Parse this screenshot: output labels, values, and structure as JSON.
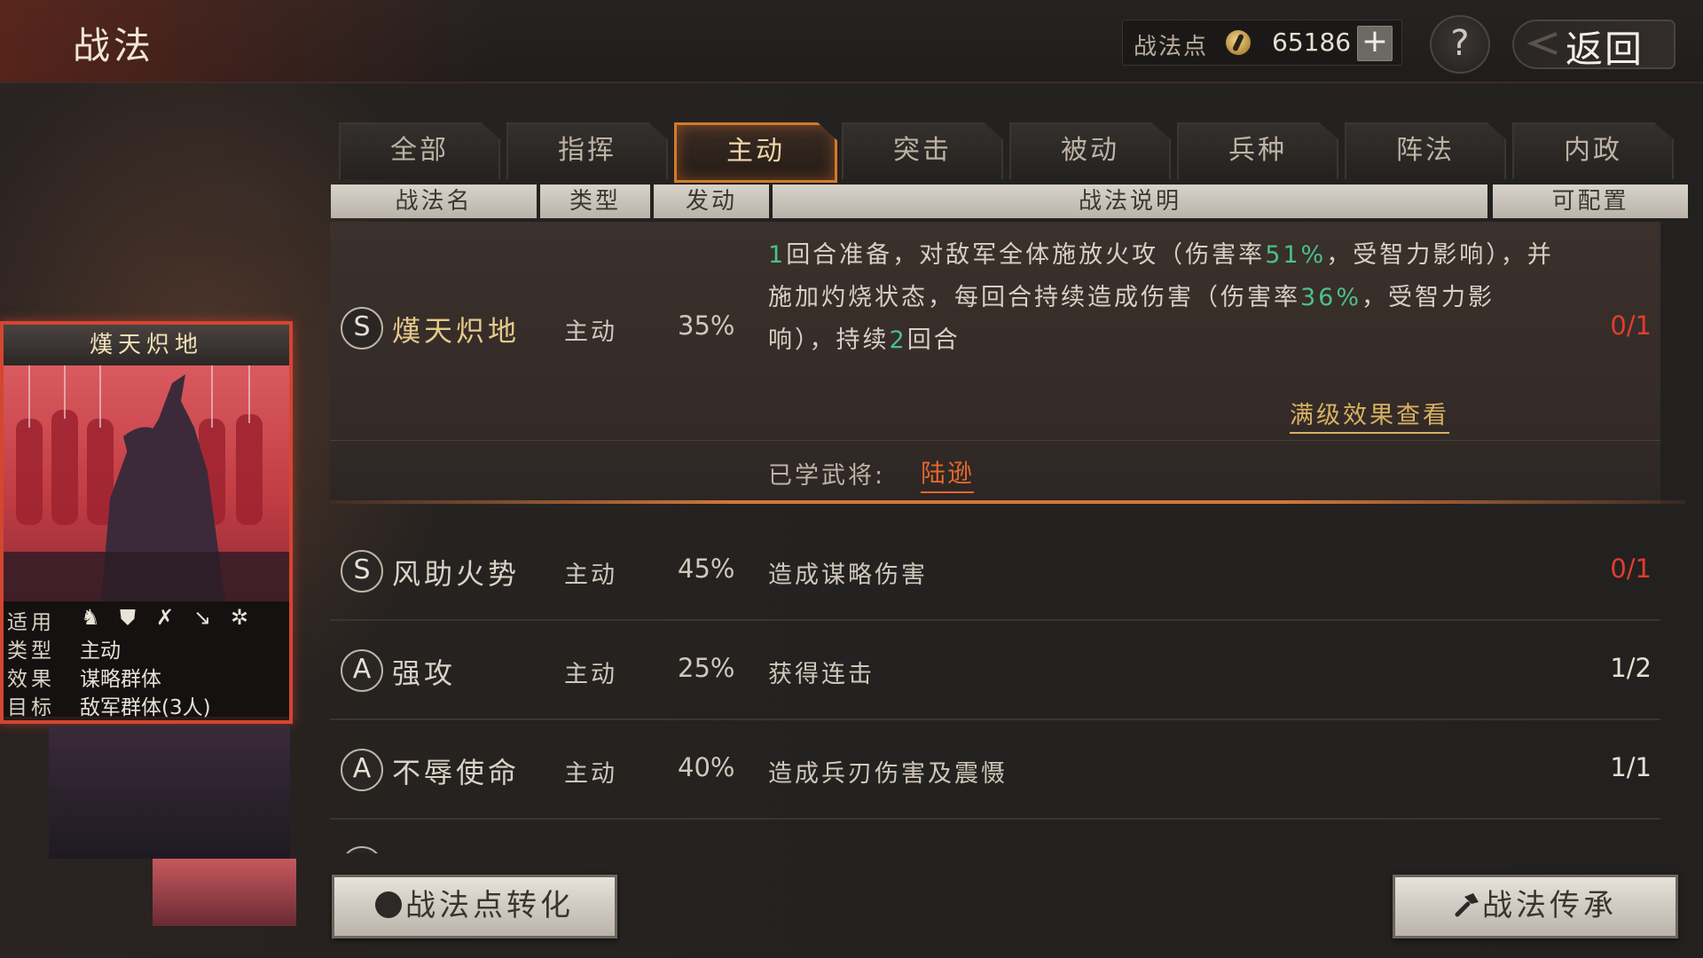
{
  "header": {
    "title": "战法",
    "points_label": "战法点",
    "points_value": "65186",
    "plus_label": "+",
    "help_label": "?",
    "back_label": "返回"
  },
  "tabs": [
    {
      "label": "全部"
    },
    {
      "label": "指挥"
    },
    {
      "label": "主动",
      "active": true
    },
    {
      "label": "突击"
    },
    {
      "label": "被动"
    },
    {
      "label": "兵种"
    },
    {
      "label": "阵法"
    },
    {
      "label": "内政"
    }
  ],
  "columns": {
    "name": "战法名",
    "type": "类型",
    "trigger": "发动",
    "desc": "战法说明",
    "config": "可配置"
  },
  "card": {
    "title": "熯天炽地",
    "rows": [
      {
        "key": "适用",
        "value": ""
      },
      {
        "key": "类型",
        "value": "主动"
      },
      {
        "key": "效果",
        "value": "谋略群体"
      },
      {
        "key": "目标",
        "value": "敌军群体(3人)"
      }
    ],
    "unit_icons": [
      "cavalry-icon",
      "shield-icon",
      "bow-icon",
      "spear-icon",
      "wheel-icon"
    ]
  },
  "skills": [
    {
      "grade": "S",
      "name": "熯天炽地",
      "type": "主动",
      "rate": "35%",
      "desc_parts": {
        "p1": "1",
        "p2": "回合准备，对敌军全体施放火攻（伤害率",
        "p3": "51%",
        "p4": "，受智力影响），并施加灼烧状态，每回合持续造成伤害（伤害率",
        "p5": "36%",
        "p6": "，受智力影响），持续",
        "p7": "2",
        "p8": "回合"
      },
      "count": "0/1",
      "full_effect_link": "满级效果查看",
      "learned_label": "已学武将:",
      "learned_name": "陆逊"
    },
    {
      "grade": "S",
      "name": "风助火势",
      "type": "主动",
      "rate": "45%",
      "desc": "造成谋略伤害",
      "count": "0/1"
    },
    {
      "grade": "A",
      "name": "强攻",
      "type": "主动",
      "rate": "25%",
      "desc": "获得连击",
      "count": "1/2"
    },
    {
      "grade": "A",
      "name": "不辱使命",
      "type": "主动",
      "rate": "40%",
      "desc": "造成兵刃伤害及震慑",
      "count": "1/1"
    }
  ],
  "footer": {
    "convert_label": "战法点转化",
    "inherit_label": "战法传承"
  },
  "colors": {
    "accent_orange": "#d27a2c",
    "count_red": "#e33b2e",
    "highlight_green": "#4cc08a",
    "card_border": "#d34630"
  }
}
